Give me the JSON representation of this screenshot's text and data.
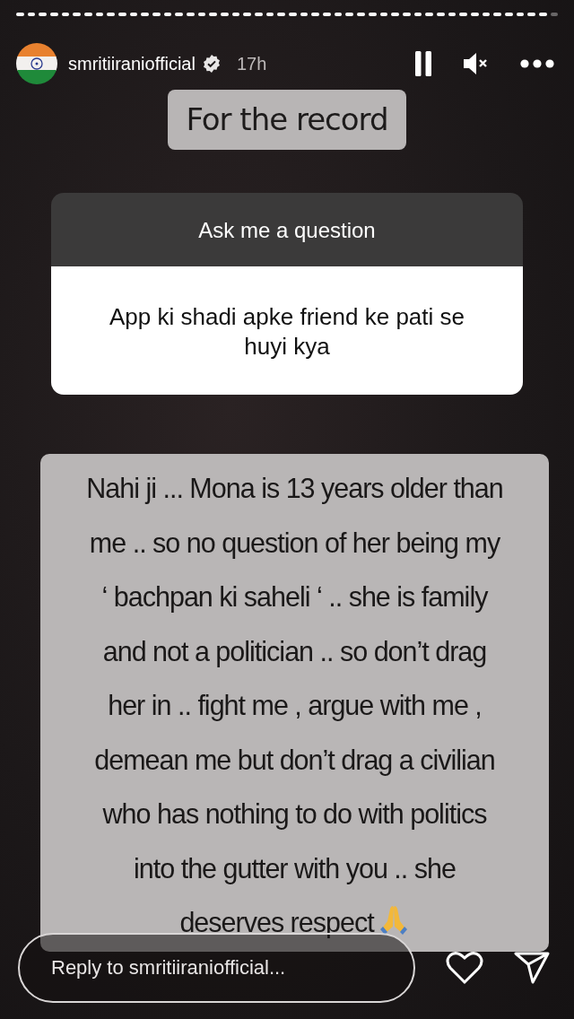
{
  "progress": {
    "segments": [
      {
        "viewed": true
      },
      {
        "viewed": true
      },
      {
        "viewed": true
      },
      {
        "viewed": true
      },
      {
        "viewed": true
      },
      {
        "viewed": true
      },
      {
        "viewed": true
      },
      {
        "viewed": true
      },
      {
        "viewed": true
      },
      {
        "viewed": true
      },
      {
        "viewed": true
      },
      {
        "viewed": true
      },
      {
        "viewed": true
      },
      {
        "viewed": true
      },
      {
        "viewed": true
      },
      {
        "viewed": true
      },
      {
        "viewed": true
      },
      {
        "viewed": true
      },
      {
        "viewed": true
      },
      {
        "viewed": true
      },
      {
        "viewed": true
      },
      {
        "viewed": true
      },
      {
        "viewed": true
      },
      {
        "viewed": true
      },
      {
        "viewed": true
      },
      {
        "viewed": true
      },
      {
        "viewed": true
      },
      {
        "viewed": true
      },
      {
        "viewed": true
      },
      {
        "viewed": true
      },
      {
        "viewed": true
      },
      {
        "viewed": true
      },
      {
        "viewed": true
      },
      {
        "viewed": true
      },
      {
        "viewed": true
      },
      {
        "viewed": true
      },
      {
        "viewed": true
      },
      {
        "viewed": true
      },
      {
        "viewed": true
      },
      {
        "viewed": true
      },
      {
        "viewed": true
      },
      {
        "viewed": true
      },
      {
        "viewed": true
      },
      {
        "viewed": true
      },
      {
        "viewed": true
      },
      {
        "viewed": true
      },
      {
        "viewed": true
      },
      {
        "viewed": false
      }
    ]
  },
  "header": {
    "username": "smritiiraniofficial",
    "verified": true,
    "time": "17h",
    "paused": false,
    "muted": true
  },
  "label": "For the record",
  "question_card": {
    "title": "Ask me a question",
    "question": "App ki shadi apke friend ke pati se huyi kya"
  },
  "answer": {
    "lines": [
      "Nahi ji ... Mona is 13 years older than",
      "me .. so no question of her being my",
      "‘ bachpan ki saheli ‘  .. she is family",
      "and not a politician .. so don’t drag",
      "her in .. fight me , argue with me ,",
      "demean me but don’t drag a civilian",
      "who has nothing to do with politics",
      "into the gutter with you .. she",
      "deserves respect"
    ]
  },
  "reply": {
    "placeholder": "Reply to smritiiraniofficial..."
  }
}
